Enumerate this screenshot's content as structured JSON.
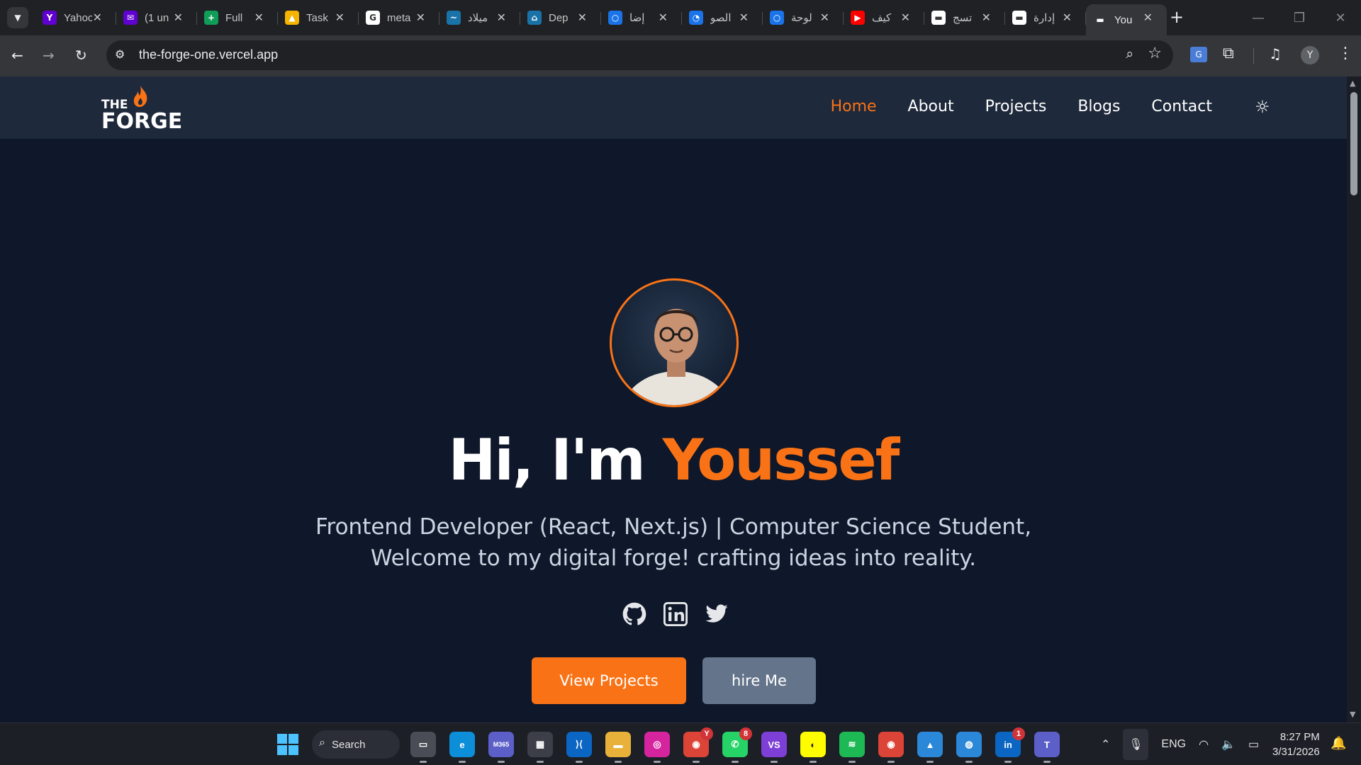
{
  "browser": {
    "tab_search_icon": "chevron-down-icon",
    "tabs": [
      {
        "title": "Yahoo",
        "favicon_color": "#6001d2",
        "favicon_text": "Y"
      },
      {
        "title": "(1 un",
        "favicon_color": "#6001d2",
        "favicon_text": "✉"
      },
      {
        "title": "Full",
        "favicon_color": "#0f9d58",
        "favicon_text": "+"
      },
      {
        "title": "Task",
        "favicon_color": "#f4b400",
        "favicon_text": "▲"
      },
      {
        "title": "meta",
        "favicon_color": "#ffffff",
        "favicon_text": "G"
      },
      {
        "title": "ميلاد",
        "favicon_color": "#1a73a8",
        "favicon_text": "~"
      },
      {
        "title": "Dep",
        "favicon_color": "#1a73a8",
        "favicon_text": "⌂"
      },
      {
        "title": "إضا",
        "favicon_color": "#1a73e8",
        "favicon_text": "○"
      },
      {
        "title": "الصو",
        "favicon_color": "#1a73e8",
        "favicon_text": "◔"
      },
      {
        "title": "لوحة",
        "favicon_color": "#1a73e8",
        "favicon_text": "○"
      },
      {
        "title": "كيف",
        "favicon_color": "#ff0000",
        "favicon_text": "▶"
      },
      {
        "title": "تسج",
        "favicon_color": "#ffffff",
        "favicon_text": "▬"
      },
      {
        "title": "إدارة",
        "favicon_color": "#ffffff",
        "favicon_text": "▬"
      },
      {
        "title": "You",
        "favicon_color": "#35363a",
        "favicon_text": "▬",
        "active": true
      }
    ],
    "new_tab_label": "+",
    "url": "the-forge-one.vercel.app",
    "profile_initial": "Y"
  },
  "site": {
    "logo_top": "THE",
    "logo_bottom": "FORGE",
    "nav": [
      "Home",
      "About",
      "Projects",
      "Blogs",
      "Contact"
    ],
    "active_nav": "Home",
    "hero_greeting": "Hi, I'm ",
    "hero_name": "Youssef",
    "hero_line1": "Frontend Developer (React, Next.js) | Computer Science Student,",
    "hero_line2": "Welcome to my digital forge! crafting ideas into reality.",
    "socials": [
      "github-icon",
      "linkedin-icon",
      "twitter-icon"
    ],
    "btn_projects": "View Projects",
    "btn_hire": "hire Me",
    "accent": "#f97316"
  },
  "taskbar": {
    "search_label": "Search",
    "apps": [
      {
        "name": "task-view",
        "color": "#4a4d55",
        "text": "▭"
      },
      {
        "name": "edge",
        "color": "#0c8ed9",
        "text": "e"
      },
      {
        "name": "m365",
        "color": "#5b5fc7",
        "text": "M365"
      },
      {
        "name": "store",
        "color": "#3c3f48",
        "text": "▦"
      },
      {
        "name": "vscode",
        "color": "#0a66c2",
        "text": "⟩⟨"
      },
      {
        "name": "explorer",
        "color": "#e8b23a",
        "text": "▬"
      },
      {
        "name": "instagram",
        "color": "#d6249f",
        "text": "◎"
      },
      {
        "name": "chrome",
        "color": "#db4437",
        "text": "◉",
        "badge": "Y"
      },
      {
        "name": "whatsapp",
        "color": "#25d366",
        "text": "✆",
        "badge": "8"
      },
      {
        "name": "visual-studio",
        "color": "#7e3fd6",
        "text": "VS"
      },
      {
        "name": "snapchat",
        "color": "#fffc00",
        "text": "◐"
      },
      {
        "name": "spotify",
        "color": "#1db954",
        "text": "≋"
      },
      {
        "name": "chrome-profile",
        "color": "#db4437",
        "text": "◉"
      },
      {
        "name": "photos",
        "color": "#2b88d8",
        "text": "▲"
      },
      {
        "name": "globe",
        "color": "#2b88d8",
        "text": "◍"
      },
      {
        "name": "linkedin",
        "color": "#0a66c2",
        "text": "in",
        "badge": "1"
      },
      {
        "name": "teams",
        "color": "#5b5fc7",
        "text": "T"
      }
    ],
    "lang": "ENG",
    "time": "8:27 PM",
    "date": "3/31/2026"
  }
}
